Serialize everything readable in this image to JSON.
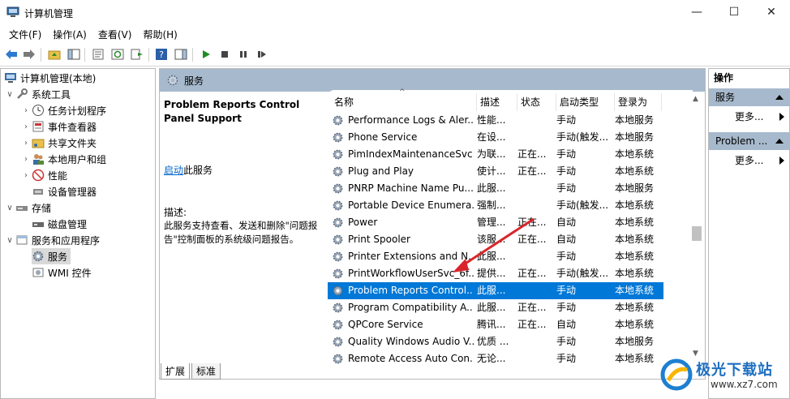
{
  "window": {
    "title": "计算机管理",
    "minimize": "—",
    "maximize": "☐",
    "close": "✕"
  },
  "menu": [
    "文件(F)",
    "操作(A)",
    "查看(V)",
    "帮助(H)"
  ],
  "tree": {
    "root": "计算机管理(本地)",
    "system_tools": "系统工具",
    "task_scheduler": "任务计划程序",
    "event_viewer": "事件查看器",
    "shared_folders": "共享文件夹",
    "local_users": "本地用户和组",
    "performance": "性能",
    "device_manager": "设备管理器",
    "storage": "存储",
    "disk_management": "磁盘管理",
    "services_apps": "服务和应用程序",
    "services": "服务",
    "wmi": "WMI 控件"
  },
  "center": {
    "header": "服务",
    "detail_title": "Problem Reports Control Panel Support",
    "start_link": "启动",
    "start_suffix": "此服务",
    "desc_label": "描述:",
    "desc_text": "此服务支持查看、发送和删除\"问题报告\"控制面板的系统级问题报告。"
  },
  "columns": {
    "name": "名称",
    "desc": "描述",
    "status": "状态",
    "startup": "启动类型",
    "logon": "登录为"
  },
  "rows": [
    {
      "name": "Performance Logs & Aler...",
      "desc": "性能...",
      "status": "",
      "startup": "手动",
      "logon": "本地服务"
    },
    {
      "name": "Phone Service",
      "desc": "在设...",
      "status": "",
      "startup": "手动(触发...",
      "logon": "本地服务"
    },
    {
      "name": "PimIndexMaintenanceSvc...",
      "desc": "为联...",
      "status": "正在...",
      "startup": "手动",
      "logon": "本地系统"
    },
    {
      "name": "Plug and Play",
      "desc": "使计...",
      "status": "正在...",
      "startup": "手动",
      "logon": "本地系统"
    },
    {
      "name": "PNRP Machine Name Pu...",
      "desc": "此服...",
      "status": "",
      "startup": "手动",
      "logon": "本地服务"
    },
    {
      "name": "Portable Device Enumera...",
      "desc": "强制...",
      "status": "",
      "startup": "手动(触发...",
      "logon": "本地系统"
    },
    {
      "name": "Power",
      "desc": "管理...",
      "status": "正在...",
      "startup": "自动",
      "logon": "本地系统"
    },
    {
      "name": "Print Spooler",
      "desc": "该服...",
      "status": "正在...",
      "startup": "自动",
      "logon": "本地系统"
    },
    {
      "name": "Printer Extensions and N...",
      "desc": "此服...",
      "status": "",
      "startup": "手动",
      "logon": "本地系统"
    },
    {
      "name": "PrintWorkflowUserSvc_6f...",
      "desc": "提供...",
      "status": "正在...",
      "startup": "手动(触发...",
      "logon": "本地系统"
    },
    {
      "name": "Problem Reports Control...",
      "desc": "此服...",
      "status": "",
      "startup": "手动",
      "logon": "本地系统"
    },
    {
      "name": "Program Compatibility A...",
      "desc": "此服...",
      "status": "正在...",
      "startup": "手动",
      "logon": "本地系统"
    },
    {
      "name": "QPCore Service",
      "desc": "腾讯...",
      "status": "正在...",
      "startup": "自动",
      "logon": "本地系统"
    },
    {
      "name": "Quality Windows Audio V...",
      "desc": "优质 ...",
      "status": "",
      "startup": "手动",
      "logon": "本地服务"
    },
    {
      "name": "Remote Access Auto Con...",
      "desc": "无论...",
      "status": "",
      "startup": "手动",
      "logon": "本地系统"
    }
  ],
  "selected_row": 10,
  "tabs": {
    "extended": "扩展",
    "standard": "标准"
  },
  "actions": {
    "title": "操作",
    "section1": "服务",
    "more1": "更多...",
    "section2": "Problem ...",
    "more2": "更多..."
  },
  "watermark": {
    "brand": "极光下载站",
    "url": "www.xz7.com"
  },
  "colors": {
    "header_blue": "#a7b9cc",
    "selection": "#0078d7",
    "arrow": "#d9252a"
  }
}
